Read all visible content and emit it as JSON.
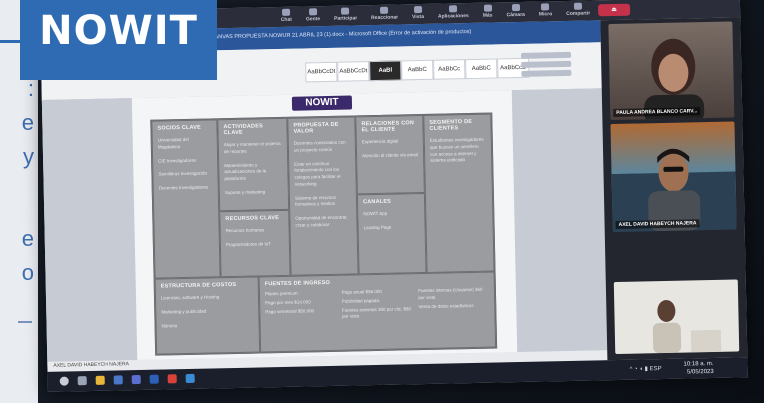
{
  "overlay": {
    "logo_text": "NOWIT"
  },
  "slide_strip": {
    "fragments": [
      ":",
      "e",
      "y",
      "e",
      "o"
    ]
  },
  "teams": {
    "controls": [
      "Chat",
      "Gente",
      "Participar",
      "Reaccionar",
      "Vista",
      "Aplicaciones",
      "Más"
    ],
    "extra": [
      "Cámara",
      "Micro",
      "Compartir"
    ]
  },
  "word": {
    "window_title": "CANVAS PROPUESTA NOWUR 21 ABRIL 23 (1).docx - Microsoft Office (Error de activación de productos)",
    "share_label": "Compartir",
    "styles": [
      "AaBbCcDt",
      "AaBbCcDt",
      "AaBl",
      "AaBbC",
      "AaBbCc",
      "AaBbC",
      "AaBbCcD"
    ],
    "status_text": "AXEL DAVID HABEYCH NAJERA"
  },
  "canvas": {
    "header_logo": "NOWIT",
    "cells": [
      {
        "title": "SOCIOS CLAVE",
        "items": [
          "Universidad del Magdalena",
          "CIE Investigadores",
          "Semilleros Investigación",
          "Docentes Investigadores"
        ]
      },
      {
        "title": "ACTIVIDADES CLAVE",
        "items": [
          "Alojar y mantener el sistema de reportes",
          "Mantenimiento y actualizaciones de la plataforma",
          "Soporte y marketing"
        ]
      },
      {
        "title": "PROPUESTA DE VALOR",
        "items": [
          "Docentes conectados con un proyecto común",
          "Estar en continuo fortalecimiento con los colegas para facilitar el networking",
          "Sistema de recursos formativos y medios",
          "Oportunidad de encontrar, crear y colaborar"
        ]
      },
      {
        "title": "RELACIONES CON EL CLIENTE",
        "items": [
          "Experiencia digital",
          "Atención al cliente vía email"
        ]
      },
      {
        "title": "SEGMENTO DE CLIENTES",
        "items": [
          "Estudiantes investigadores que buscan un semillero con acceso a internet y sistema unificado"
        ]
      },
      {
        "title": "RECURSOS CLAVE",
        "items": [
          "Recursos humanos",
          "Programadores de IoT"
        ]
      },
      {
        "title": "CANALES",
        "items": [
          "NOWIT App",
          "Landing Page"
        ]
      },
      {
        "title": "ESTRUCTURA DE COSTOS",
        "items": [
          "Licencias, software y Hosting",
          "Marketing y publicidad",
          "Nómina"
        ]
      },
      {
        "title": "FUENTES DE INGRESO",
        "items": [
          "Planes premium:",
          "Pago por mes $14.000",
          "Pago semestral $50.000",
          "Pago anual $96.000",
          "Publicidad pagada:",
          "Fuentes externas 360 por clic, $80 por vista",
          "Fuentes internas (Usuarios) 360 por vista",
          "Venta de datos estadísticos"
        ]
      }
    ]
  },
  "taskbar": {
    "time": "10:18 a. m.",
    "date": "5/05/2023",
    "lang": "ESP"
  },
  "participants": [
    {
      "name": "PAULA ANDREA BLANCO CARV..."
    },
    {
      "name": "AXEL DAVID HABEYCH NAJERA"
    },
    {
      "name": ""
    }
  ]
}
